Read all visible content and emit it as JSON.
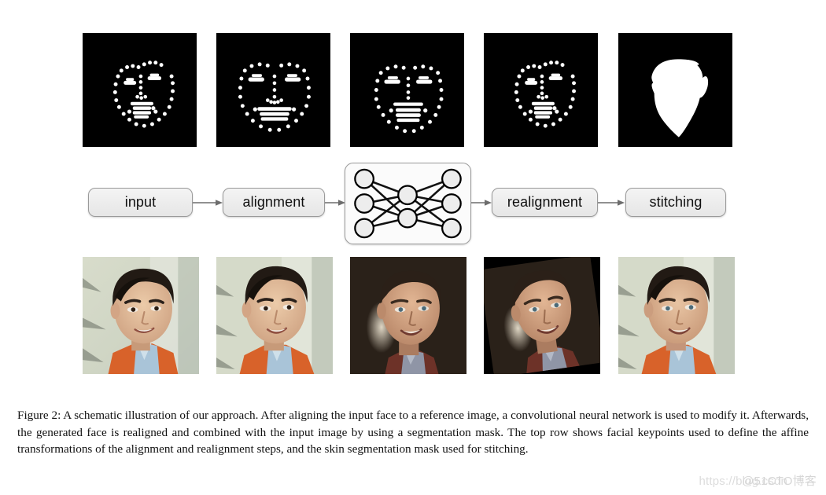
{
  "figure": {
    "caption_label": "Figure 2:",
    "caption_text": "A schematic illustration of our approach. After aligning the input face to a reference image, a convolutional neural network is used to modify it. Afterwards, the generated face is realigned and combined with the input image by using a segmentation mask. The top row shows facial keypoints used to define the affine transformations of the alignment and realignment steps, and the skin segmentation mask used for stitching."
  },
  "pipeline": {
    "steps": [
      {
        "label": "input",
        "name": "input"
      },
      {
        "label": "alignment",
        "name": "alignment"
      },
      {
        "label": "",
        "name": "neural-network"
      },
      {
        "label": "realignment",
        "name": "realignment"
      },
      {
        "label": "stitching",
        "name": "stitching"
      }
    ],
    "network": {
      "input_nodes": 3,
      "hidden_nodes": 2,
      "output_nodes": 3,
      "node_fill": "#ededed",
      "node_stroke": "#000000",
      "edge_color": "#111111"
    },
    "arrow_color": "#6d6d6d",
    "box_fill": "#ececec",
    "box_border": "#9a9a9a"
  },
  "top_row": {
    "description": "facial keypoints and skin segmentation mask",
    "background": "#000000",
    "foreground": "#ffffff",
    "tiles": [
      {
        "name": "keypoints-input",
        "kind": "keypoints",
        "caption_role": "input keypoints"
      },
      {
        "name": "keypoints-aligned",
        "kind": "keypoints",
        "caption_role": "aligned keypoints"
      },
      {
        "name": "keypoints-generated",
        "kind": "keypoints",
        "caption_role": "generated keypoints"
      },
      {
        "name": "keypoints-realigned",
        "kind": "keypoints",
        "caption_role": "realigned keypoints"
      },
      {
        "name": "segmentation-mask",
        "kind": "mask",
        "caption_role": "skin segmentation mask"
      }
    ]
  },
  "bottom_row": {
    "description": "face photographs through the pipeline",
    "tiles": [
      {
        "name": "photo-input",
        "kind": "photo",
        "caption_role": "input face"
      },
      {
        "name": "photo-aligned",
        "kind": "photo",
        "caption_role": "aligned face"
      },
      {
        "name": "photo-generated",
        "kind": "photo-dark",
        "caption_role": "generated face"
      },
      {
        "name": "photo-realigned",
        "kind": "photo-rotated",
        "caption_role": "realigned face"
      },
      {
        "name": "photo-stitched",
        "kind": "photo",
        "caption_role": "stitched result"
      }
    ]
  },
  "watermark": {
    "url": "https://blog.csdn",
    "brand": "@51CTO博客"
  }
}
